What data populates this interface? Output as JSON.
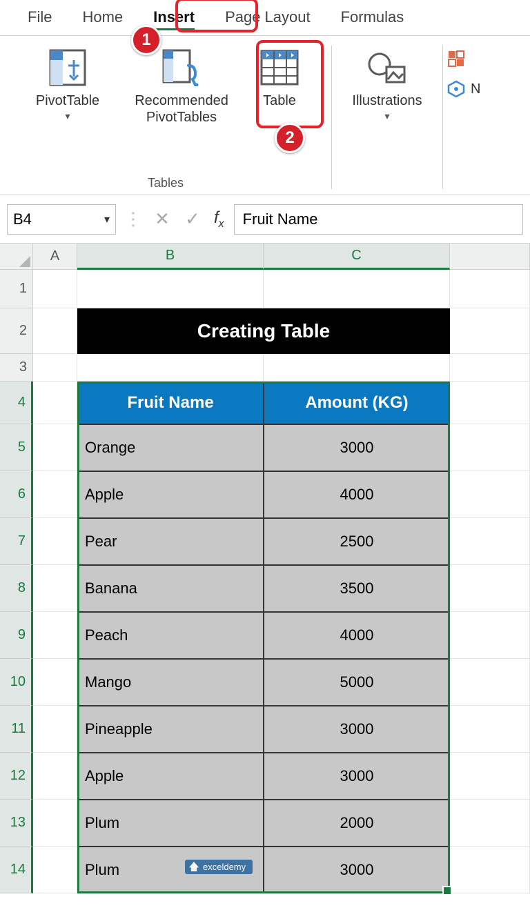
{
  "tabs": {
    "file": "File",
    "home": "Home",
    "insert": "Insert",
    "pagelayout": "Page Layout",
    "formulas": "Formulas"
  },
  "ribbon": {
    "tables_group_label": "Tables",
    "pivot_label_line1": "PivotTable",
    "recpivot_line1": "Recommended",
    "recpivot_line2": "PivotTables",
    "table_label": "Table",
    "illus_label": "Illustrations",
    "callout1": "1",
    "callout2": "2"
  },
  "formula_bar": {
    "namebox": "B4",
    "value": "Fruit Name"
  },
  "columns": {
    "A": "A",
    "B": "B",
    "C": "C"
  },
  "rows": [
    "1",
    "2",
    "3",
    "4",
    "5",
    "6",
    "7",
    "8",
    "9",
    "10",
    "11",
    "12",
    "13",
    "14"
  ],
  "banner": "Creating Table",
  "table": {
    "header_fruit": "Fruit Name",
    "header_amount": "Amount (KG)",
    "rows": [
      {
        "fruit": "Orange",
        "amount": "3000"
      },
      {
        "fruit": "Apple",
        "amount": "4000"
      },
      {
        "fruit": "Pear",
        "amount": "2500"
      },
      {
        "fruit": "Banana",
        "amount": "3500"
      },
      {
        "fruit": "Peach",
        "amount": "4000"
      },
      {
        "fruit": "Mango",
        "amount": "5000"
      },
      {
        "fruit": "Pineapple",
        "amount": "3000"
      },
      {
        "fruit": "Apple",
        "amount": "3000"
      },
      {
        "fruit": "Plum",
        "amount": "2000"
      },
      {
        "fruit": "Plum",
        "amount": "3000"
      }
    ]
  },
  "watermark": "exceldemy"
}
